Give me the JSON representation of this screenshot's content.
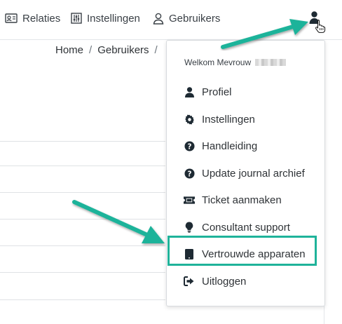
{
  "nav": {
    "items": [
      {
        "label": "Relaties",
        "icon": "contact-card-icon"
      },
      {
        "label": "Instellingen",
        "icon": "sliders-icon"
      },
      {
        "label": "Gebruikers",
        "icon": "user-outline-icon"
      }
    ],
    "user_icon": "user-icon"
  },
  "breadcrumb": {
    "items": [
      "Home",
      "Gebruikers"
    ],
    "separator": "/"
  },
  "dropdown": {
    "welcome": "Welkom Mevrouw",
    "items": [
      {
        "label": "Profiel",
        "icon": "user-icon"
      },
      {
        "label": "Instellingen",
        "icon": "gear-icon"
      },
      {
        "label": "Handleiding",
        "icon": "question-circle-icon"
      },
      {
        "label": "Update journal archief",
        "icon": "question-circle-icon"
      },
      {
        "label": "Ticket aanmaken",
        "icon": "ticket-icon"
      },
      {
        "label": "Consultant support",
        "icon": "lightbulb-icon"
      },
      {
        "label": "Vertrouwde apparaten",
        "icon": "tablet-icon"
      },
      {
        "label": "Uitloggen",
        "icon": "sign-out-icon"
      }
    ]
  },
  "colors": {
    "annotation": "#1fb39a",
    "text": "#2f3337"
  }
}
